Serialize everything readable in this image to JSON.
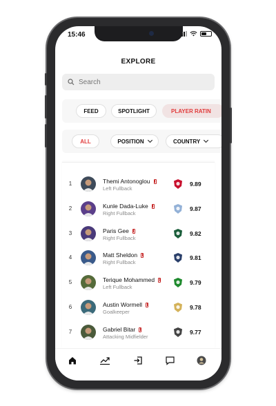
{
  "status": {
    "time": "15:46"
  },
  "header": {
    "title": "EXPLORE"
  },
  "search": {
    "placeholder": "Search"
  },
  "tabs": [
    {
      "label": "FEED",
      "active": false
    },
    {
      "label": "SPOTLIGHT",
      "active": false
    },
    {
      "label": "PLAYER RATIN",
      "active": true
    }
  ],
  "filters": {
    "all_label": "ALL",
    "position_label": "POSITION",
    "country_label": "COUNTRY"
  },
  "players": [
    {
      "rank": "1",
      "name": "Themi Antonoglou",
      "position": "Left Fullback",
      "rating": "9.89",
      "club_icon": "toronto-fc-crest-icon",
      "club_color": "#c8102e",
      "avatar_color": "#3e4b5a"
    },
    {
      "rank": "2",
      "name": "Kunle Dada-Luke",
      "position": "Right Fullback",
      "rating": "9.87",
      "club_icon": "sporting-kc-crest-icon",
      "club_color": "#93b1d7",
      "avatar_color": "#5b3f8a"
    },
    {
      "rank": "3",
      "name": "Paris Gee",
      "position": "Right Fullback",
      "rating": "9.82",
      "club_icon": "portland-timbers-crest-icon",
      "club_color": "#1a5d3a",
      "avatar_color": "#4a3a7a"
    },
    {
      "rank": "4",
      "name": "Matt Sheldon",
      "position": "Right Fullback",
      "rating": "9.81",
      "club_icon": "new-york-city-fc-crest-icon",
      "club_color": "#2a3f6a",
      "avatar_color": "#3a5a8a"
    },
    {
      "rank": "5",
      "name": "Terique Mohammed",
      "position": "Left Fullback",
      "rating": "9.79",
      "club_icon": "austin-fc-crest-icon",
      "club_color": "#1f8a2e",
      "avatar_color": "#556b3a"
    },
    {
      "rank": "6",
      "name": "Austin Wormell",
      "position": "Goalkeeper",
      "rating": "9.78",
      "club_icon": "la-galaxy-crest-icon",
      "club_color": "#d4b25a",
      "avatar_color": "#3b6a7a"
    },
    {
      "rank": "7",
      "name": "Gabriel Bitar",
      "position": "Attacking Midfielder",
      "rating": "9.77",
      "club_icon": "vancouver-crest-icon",
      "club_color": "#444444",
      "avatar_color": "#4a5a3a"
    }
  ],
  "tabbar": [
    {
      "icon": "home-icon",
      "active": true
    },
    {
      "icon": "trending-icon",
      "active": false
    },
    {
      "icon": "login-icon",
      "active": false
    },
    {
      "icon": "chat-icon",
      "active": false
    },
    {
      "icon": "profile-icon",
      "active": false
    }
  ],
  "colors": {
    "accent": "#e13b3b",
    "accent_bg": "#f1e3e3"
  }
}
